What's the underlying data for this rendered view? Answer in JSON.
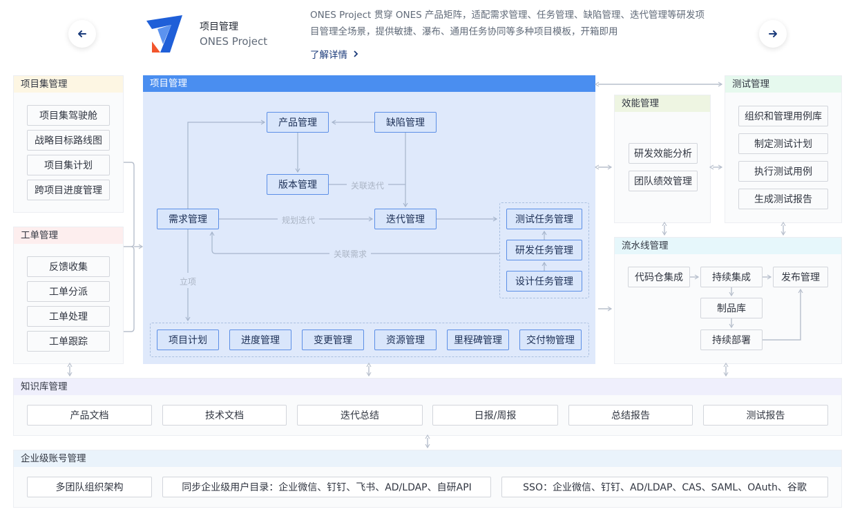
{
  "header": {
    "product_title": "项目管理",
    "product_name": "ONES Project",
    "description_line1": "ONES Project 贯穿 ONES 产品矩阵，适配需求管理、任务管理、缺陷管理、迭代管理等研发项",
    "description_line2": "目管理全场景，提供敏捷、瀑布、通用任务协同等多种项目模板，开箱即用",
    "learn_more": "了解详情",
    "logo_colors": [
      "#1f5fd8",
      "#f2552c"
    ]
  },
  "program": {
    "title": "项目集管理",
    "items": [
      "项目集驾驶舱",
      "战略目标路线图",
      "项目集计划",
      "跨项目进度管理"
    ]
  },
  "ticket": {
    "title": "工单管理",
    "items": [
      "反馈收集",
      "工单分派",
      "工单处理",
      "工单跟踪"
    ]
  },
  "project": {
    "title": "项目管理",
    "product_mgmt": "产品管理",
    "defect_mgmt": "缺陷管理",
    "version_mgmt": "版本管理",
    "requirement_mgmt": "需求管理",
    "iteration_mgmt": "迭代管理",
    "tasks": [
      "测试任务管理",
      "研发任务管理",
      "设计任务管理"
    ],
    "bottom": [
      "项目计划",
      "进度管理",
      "变更管理",
      "资源管理",
      "里程碑管理",
      "交付物管理"
    ],
    "labels": {
      "link_iteration": "关联迭代",
      "plan_iteration": "规划迭代",
      "link_requirement": "关联需求",
      "initiate": "立项"
    }
  },
  "efficiency": {
    "title": "效能管理",
    "items": [
      "研发效能分析",
      "团队绩效管理"
    ]
  },
  "testing": {
    "title": "测试管理",
    "items": [
      "组织和管理用例库",
      "制定测试计划",
      "执行测试用例",
      "生成测试报告"
    ]
  },
  "pipeline": {
    "title": "流水线管理",
    "code_repo": "代码仓集成",
    "ci": "持续集成",
    "release": "发布管理",
    "artifact": "制品库",
    "cd": "持续部署"
  },
  "knowledge": {
    "title": "知识库管理",
    "items": [
      "产品文档",
      "技术文档",
      "迭代总结",
      "日报/周报",
      "总结报告",
      "测试报告"
    ]
  },
  "enterprise": {
    "title": "企业级账号管理",
    "items": [
      "多团队组织架构",
      "同步企业级用户目录：企业微信、钉钉、飞书、AD/LDAP、自研API",
      "SSO：企业微信、钉钉、AD/LDAP、CAS、SAML、OAuth、谷歌"
    ]
  },
  "colors": {
    "program_head": "#fdf6e3",
    "ticket_head": "#fdeeee",
    "project_head": "#4a8ef0",
    "efficiency_head": "#eef5e2",
    "testing_head": "#e6f9ee",
    "pipeline_head": "#e6f7fb",
    "knowledge_head": "#efeffc",
    "enterprise_head": "#eaf3fb",
    "project_bg": "#dfe9fb"
  }
}
